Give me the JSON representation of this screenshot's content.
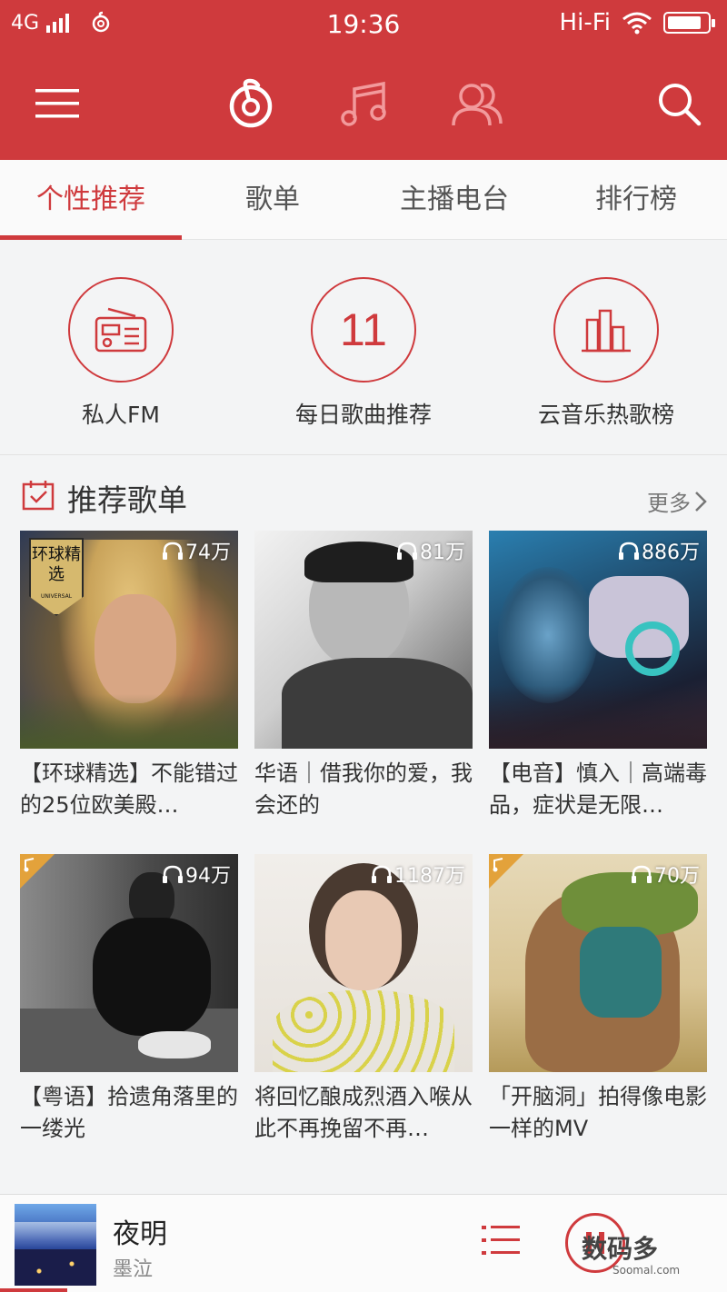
{
  "status_bar": {
    "network": "4G",
    "time": "19:36",
    "hifi": "Hi-Fi"
  },
  "top_nav": {
    "icons": [
      "menu-icon",
      "netease-music-logo-icon",
      "music-note-icon",
      "friends-icon",
      "search-icon"
    ]
  },
  "tabs": [
    {
      "label": "个性推荐",
      "active": true
    },
    {
      "label": "歌单",
      "active": false
    },
    {
      "label": "主播电台",
      "active": false
    },
    {
      "label": "排行榜",
      "active": false
    }
  ],
  "quick_entries": [
    {
      "label": "私人FM",
      "icon": "radio-icon"
    },
    {
      "label": "每日歌曲推荐",
      "number": "11"
    },
    {
      "label": "云音乐热歌榜",
      "icon": "bar-chart-icon"
    }
  ],
  "section": {
    "title": "推荐歌单",
    "more": "更多"
  },
  "playlists": [
    {
      "count": "74万",
      "caption": "【环球精选】不能错过的25位欧美殿…",
      "badge": "环球精选",
      "badge_sub": "UNIVERSAL"
    },
    {
      "count": "81万",
      "caption": "华语｜借我你的爱，我会还的"
    },
    {
      "count": "886万",
      "caption": "【电音】慎入｜高端毒品，症状是无限…"
    },
    {
      "count": "94万",
      "caption": "【粤语】拾遗角落里的一缕光",
      "corner": true
    },
    {
      "count": "1187万",
      "caption": "将回忆酿成烈酒入喉从此不再挽留不再…"
    },
    {
      "count": "70万",
      "caption": "「开脑洞」拍得像电影一样的MV",
      "corner": true
    }
  ],
  "player": {
    "title": "夜明",
    "artist": "墨泣"
  },
  "watermark": {
    "main": "数码多",
    "sub": "Soomal.com"
  },
  "colors": {
    "accent": "#cf3a3d",
    "background": "#f3f4f5",
    "corner_badge": "#e3a23b"
  }
}
